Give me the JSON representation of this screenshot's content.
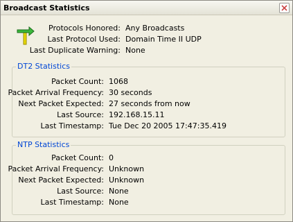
{
  "window": {
    "title": "Broadcast Statistics"
  },
  "summary": [
    {
      "label": "Protocols Honored:",
      "value": "Any Broadcasts"
    },
    {
      "label": "Last Protocol Used:",
      "value": "Domain Time II UDP"
    },
    {
      "label": "Last Duplicate Warning:",
      "value": "None"
    }
  ],
  "dt2": {
    "title": "DT2 Statistics",
    "rows": [
      {
        "label": "Packet Count:",
        "value": "1068"
      },
      {
        "label": "Packet Arrival Frequency:",
        "value": "30 seconds"
      },
      {
        "label": "Next Packet Expected:",
        "value": "27 seconds from now"
      },
      {
        "label": "Last Source:",
        "value": "192.168.15.11"
      },
      {
        "label": "Last Timestamp:",
        "value": "Tue Dec 20 2005 17:47:35.419"
      }
    ]
  },
  "ntp": {
    "title": "NTP Statistics",
    "rows": [
      {
        "label": "Packet Count:",
        "value": "0"
      },
      {
        "label": "Packet Arrival Frequency:",
        "value": "Unknown"
      },
      {
        "label": "Next Packet Expected:",
        "value": "Unknown"
      },
      {
        "label": "Last Source:",
        "value": "None"
      },
      {
        "label": "Last Timestamp:",
        "value": "None"
      }
    ]
  },
  "icons": {
    "app": "broadcast-arrow-icon",
    "close": "close-icon"
  }
}
